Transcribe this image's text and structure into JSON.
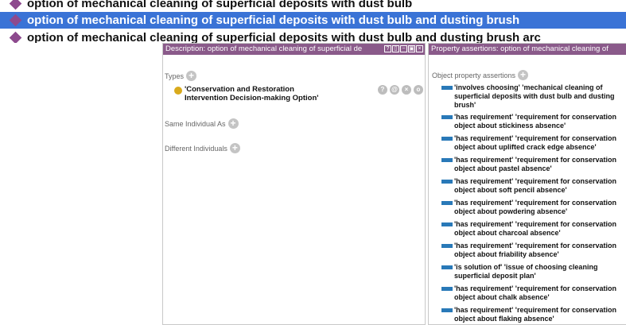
{
  "individuals": [
    "option of mechanical cleaning of superficial deposits with dust bulb",
    "option of mechanical cleaning of superficial deposits with dust bulb and dusting brush",
    "option of mechanical cleaning of superficial deposits with dust bulb and dusting brush arc"
  ],
  "description": {
    "header": "Description: option of mechanical cleaning of superficial de",
    "types_label": "Types",
    "type_value": "'Conservation and Restoration Intervention Decision-making Option'",
    "same_label": "Same Individual As",
    "different_label": "Different Individuals",
    "ctrl_labels": [
      "?",
      "@",
      "×",
      "o"
    ],
    "header_buttons": [
      "?",
      "▯",
      "−",
      "▣",
      "×"
    ]
  },
  "property": {
    "header": "Property assertions: option of mechanical cleaning of",
    "section_label": "Object property assertions",
    "assertions": [
      "'involves choosing'  'mechanical cleaning of superficial deposits with dust bulb and dusting brush'",
      "'has requirement'  'requirement for conservation object about stickiness absence'",
      "'has requirement'  'requirement for conservation object about uplifted crack edge absence'",
      "'has requirement'  'requirement for conservation object about pastel absence'",
      "'has requirement'  'requirement for conservation object about soft pencil absence'",
      "'has requirement'  'requirement for conservation object about powdering absence'",
      "'has requirement'  'requirement for conservation object about charcoal absence'",
      "'has requirement'  'requirement for conservation object about friability absence'",
      "'is solution of'  'issue of choosing cleaning superficial deposit plan'",
      "'has requirement'  'requirement for conservation object about chalk absence'",
      "'has requirement'  'requirement for conservation object about flaking absence'"
    ]
  },
  "colors": {
    "selection": "#3a73d6",
    "header": "#8a5a8a",
    "individual_icon": "#8d4a8e",
    "class_icon": "#d9aa1c",
    "property_icon": "#2979b8"
  }
}
